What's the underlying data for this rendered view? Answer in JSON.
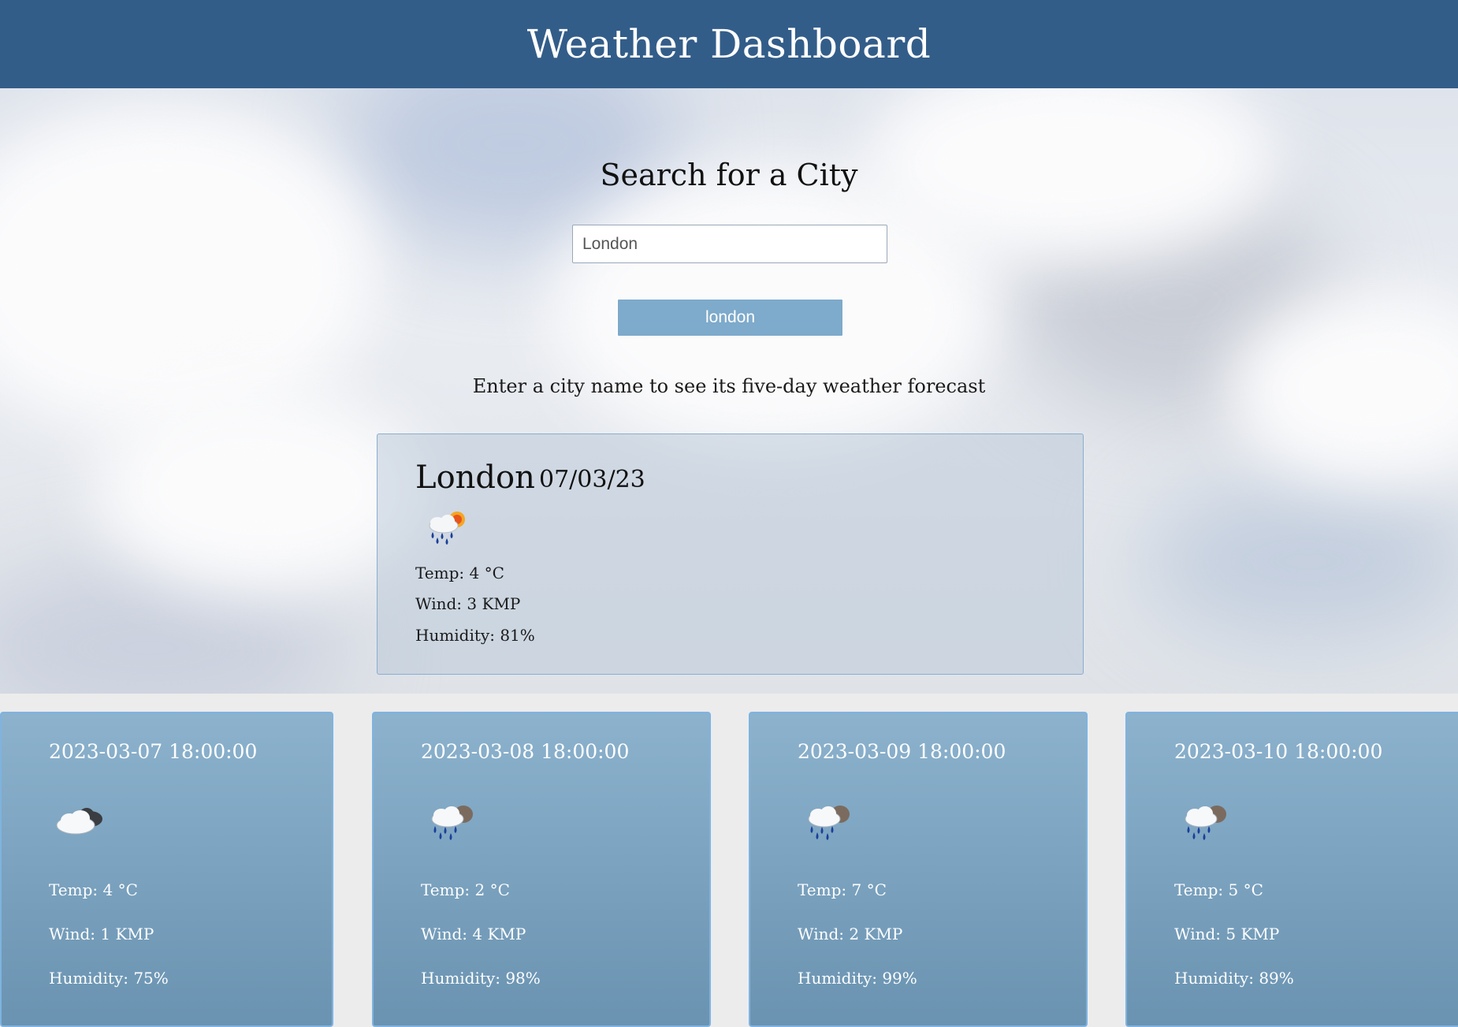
{
  "header": {
    "title": "Weather Dashboard"
  },
  "search": {
    "title": "Search for a City",
    "input_value": "London",
    "history_button": "london",
    "hint": "Enter a city name to see its five-day weather forecast"
  },
  "current": {
    "city": "London",
    "date": "07/03/23",
    "icon": "rain-sun-icon",
    "temp": "Temp: 4 °C",
    "wind": "Wind: 3 KMP",
    "humidity": "Humidity: 81%"
  },
  "forecast": [
    {
      "date": "2023-03-07 18:00:00",
      "icon": "cloudy-icon",
      "temp": "Temp: 4 °C",
      "wind": "Wind: 1 KMP",
      "humidity": "Humidity: 75%"
    },
    {
      "date": "2023-03-08 18:00:00",
      "icon": "rain-icon",
      "temp": "Temp: 2 °C",
      "wind": "Wind: 4 KMP",
      "humidity": "Humidity: 98%"
    },
    {
      "date": "2023-03-09 18:00:00",
      "icon": "rain-icon",
      "temp": "Temp: 7 °C",
      "wind": "Wind: 2 KMP",
      "humidity": "Humidity: 99%"
    },
    {
      "date": "2023-03-10 18:00:00",
      "icon": "rain-icon",
      "temp": "Temp: 5 °C",
      "wind": "Wind: 5 KMP",
      "humidity": "Humidity: 89%"
    }
  ],
  "colors": {
    "header": "#335d89",
    "button": "#7eaacb",
    "card_top": "#8cb2cd",
    "card_bottom": "#6a93b1"
  }
}
